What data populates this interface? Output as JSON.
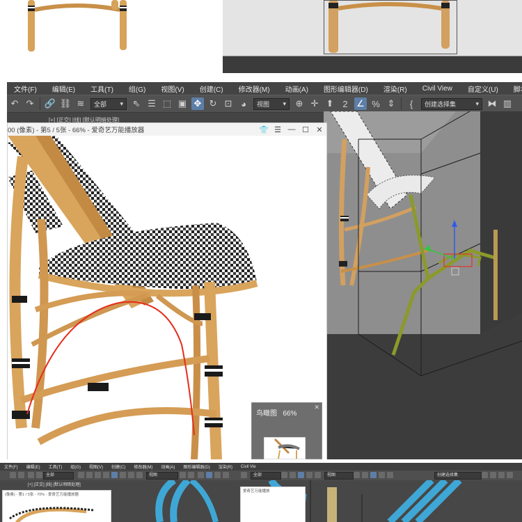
{
  "menu": [
    "文件(F)",
    "编辑(E)",
    "工具(T)",
    "组(G)",
    "视图(V)",
    "创建(C)",
    "修改器(M)",
    "动画(A)",
    "图形编辑器(D)",
    "渲染(R)",
    "Civil View",
    "自定义(U)",
    "脚本(S)"
  ],
  "toolbar": {
    "selection_filter": "全部",
    "reference_coord": "视图",
    "named_selection": "创建选择集"
  },
  "viewer": {
    "title": "00 (像素) - 第5 / 5张 - 66% - 爱奇艺万能播放器",
    "overlay_text": "[+] [正交] [线] [默认明暗处理]",
    "birdseye_label": "鸟瞰图",
    "birdseye_zoom": "66%"
  },
  "bottom": {
    "menu": [
      "文件(F)",
      "编辑(E)",
      "工具(T)",
      "组(G)",
      "视图(V)",
      "创建(C)",
      "修改器(M)",
      "动画(A)",
      "图形编辑器(D)",
      "渲染(R)",
      "Civil Vie"
    ],
    "viewport_label": "[+] [正交] [线] [默认明暗处理]",
    "viewer_title": "(像素) - 第1 / 5张 - 70% - 爱奇艺万能播放器",
    "viewer2_title": "爱奇艺万能播放",
    "dropdown_all": "全部",
    "dropdown_view": "视图",
    "dropdown_sel": "创建选择集"
  },
  "colors": {
    "app_bg": "#444444",
    "toolbar_bg": "#515151",
    "active_tool": "#5d7ea7",
    "rattan": "#d7a25a",
    "gizmo_x": "#e0332c",
    "gizmo_y": "#37c53e",
    "gizmo_z": "#2f5bea",
    "selected_spline": "#8b9a2a",
    "red_sketch": "#e62c1c",
    "tube_blue": "#3fa7d6"
  }
}
